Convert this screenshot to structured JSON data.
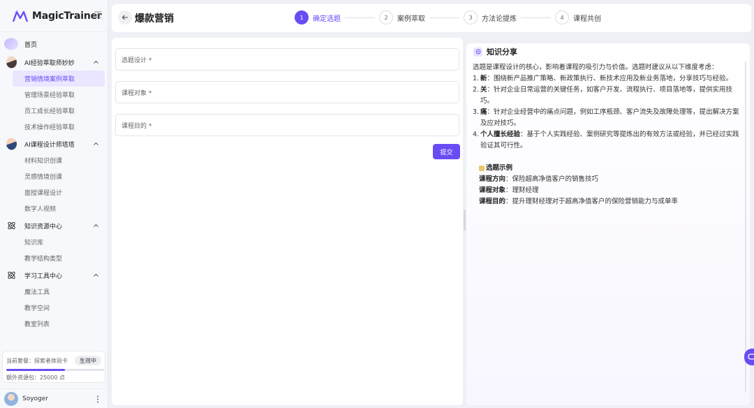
{
  "app": {
    "name": "MagicTrainer"
  },
  "sidebar": {
    "home_label": "首页",
    "groups": [
      {
        "label": "AI经验萃取师妙妙",
        "icon": "female-avatar",
        "children": [
          "营销情境案例萃取",
          "管理场景经验萃取",
          "员工成长经验萃取",
          "技术操作经验萃取"
        ]
      },
      {
        "label": "AI课程设计师塔塔",
        "icon": "male-avatar",
        "children": [
          "材料知识创课",
          "灵感情境创课",
          "面授课程设计",
          "数字人视频"
        ]
      },
      {
        "label": "知识资源中心",
        "icon": "atom-icon",
        "children": [
          "知识库",
          "教学结构类型"
        ]
      },
      {
        "label": "学习工具中心",
        "icon": "atom-icon",
        "children": [
          "魔法工具",
          "教学空间",
          "教室列表"
        ]
      }
    ],
    "active_item": "营销情境案例萃取",
    "plan": {
      "label": "当前套餐：探索者体验卡",
      "badge": "生效中",
      "progress": 0.6,
      "extra": "额外资源包：25000 点"
    },
    "user": {
      "name": "Soyoger"
    }
  },
  "header": {
    "title": "爆款营销",
    "steps": [
      {
        "num": "1",
        "label": "确定选题",
        "active": true
      },
      {
        "num": "2",
        "label": "案例萃取",
        "active": false
      },
      {
        "num": "3",
        "label": "方法论提炼",
        "active": false
      },
      {
        "num": "4",
        "label": "课程共创",
        "active": false
      }
    ]
  },
  "form": {
    "fields": [
      {
        "placeholder": "选题设计 *"
      },
      {
        "placeholder": "课程对象 *"
      },
      {
        "placeholder": "课程目的 *"
      }
    ],
    "submit_label": "提交"
  },
  "knowledge": {
    "title": "知识分享",
    "intro": "选题是课程设计的核心，影响着课程的吸引力与价值。选题时建议从以下维度考虑：",
    "items": [
      {
        "num": "1.",
        "key": "新",
        "text": "：围绕新产品推广策略、新政策执行、新技术应用及新业务落地，分享技巧与经验。"
      },
      {
        "num": "2.",
        "key": "关",
        "text": "：针对企业日常运营的关键任务，如客户开发、流程执行、项目落地等，提供实用技巧。"
      },
      {
        "num": "3.",
        "key": "痛",
        "text": "：针对企业经营中的痛点问题，例如工序瓶颈、客户流失及故障处理等，提出解决方案及应对技巧。"
      },
      {
        "num": "4.",
        "key": "个人擅长经验",
        "text": "：基于个人实践经验、案例研究等提炼出的有效方法或经验，并已经过实践验证其可行性。"
      }
    ],
    "example": {
      "title": "选题示例",
      "lines": [
        {
          "key": "课程方向",
          "text": "：保险超高净值客户的销售技巧"
        },
        {
          "key": "课程对象",
          "text": "：理财经理"
        },
        {
          "key": "课程目的",
          "text": "：提升理财经理对于超高净值客户的保险营销能力与成单率"
        }
      ]
    }
  },
  "colors": {
    "accent": "#6a4cf5",
    "accent_light": "#ebe6ff"
  }
}
